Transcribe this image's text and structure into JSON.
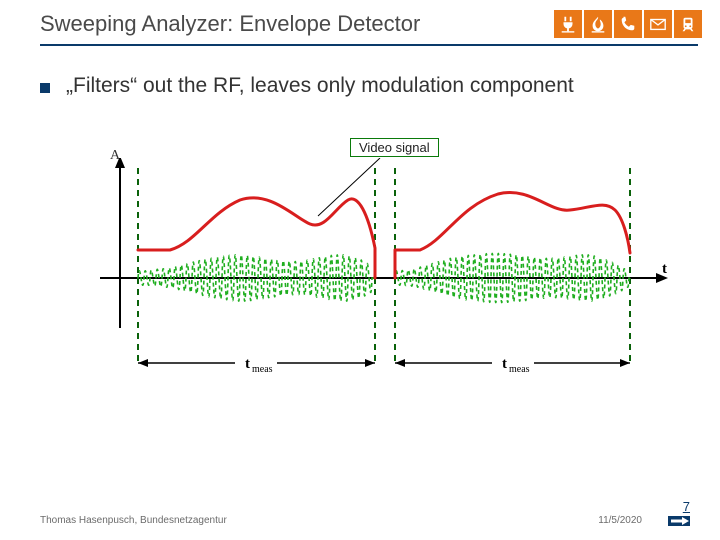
{
  "header": {
    "title": "Sweeping Analyzer: Envelope Detector",
    "icons": [
      "plug-icon",
      "flame-icon",
      "phone-icon",
      "mail-icon",
      "train-icon"
    ]
  },
  "body": {
    "bullet1": "„Filters“ out the RF, leaves only modulation component"
  },
  "diagram": {
    "y_axis_label": "A",
    "x_axis_label": "t",
    "annotation_box": "Video signal",
    "tmeas_label_left": "t",
    "tmeas_label_left_sub": "meas",
    "tmeas_label_right": "t",
    "tmeas_label_right_sub": "meas",
    "signals": {
      "rf_carrier": "green dashed high-frequency amplitude-modulated carrier",
      "envelope": "red solid rectified envelope (video signal)"
    },
    "segments": 2,
    "colors": {
      "carrier": "#1fae1f",
      "envelope": "#d81e1e",
      "axis": "#000000",
      "marker": "#0a620a"
    }
  },
  "footer": {
    "author": "Thomas Hasenpusch, Bundesnetzagentur",
    "date": "11/5/2020",
    "page": "7"
  }
}
